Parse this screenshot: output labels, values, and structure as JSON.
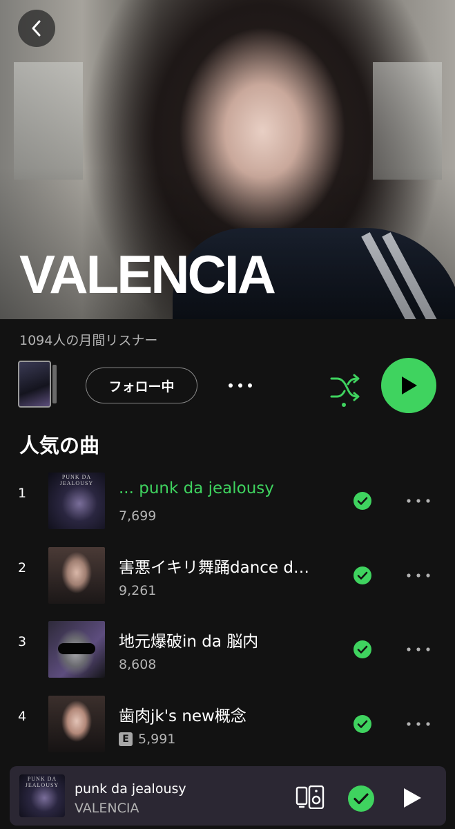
{
  "header": {
    "artist_name": "VALENCIA",
    "back_icon": "chevron-left-icon"
  },
  "stats": {
    "monthly_listeners": "1094人の月間リスナー"
  },
  "actions": {
    "follow_label": "フォロー中",
    "more_icon": "ellipsis-icon",
    "shuffle_icon": "shuffle-icon",
    "play_icon": "play-icon"
  },
  "popular": {
    "title": "人気の曲",
    "tracks": [
      {
        "number": "1",
        "title": "... punk da jealousy",
        "plays": "7,699",
        "explicit": false,
        "playing": true,
        "saved": true,
        "cover_text": "PUNK DA JEALOUSY"
      },
      {
        "number": "2",
        "title": "害悪イキリ舞踊dance d…",
        "plays": "9,261",
        "explicit": false,
        "playing": false,
        "saved": true
      },
      {
        "number": "3",
        "title": "地元爆破in da 脳内",
        "plays": "8,608",
        "explicit": false,
        "playing": false,
        "saved": true
      },
      {
        "number": "4",
        "title": "歯肉jk's new概念",
        "plays": "5,991",
        "explicit": true,
        "explicit_label": "E",
        "playing": false,
        "saved": true
      }
    ]
  },
  "now_playing": {
    "title": "punk da jealousy",
    "artist": "VALENCIA",
    "cover_text": "PUNK DA JEALOUSY",
    "device_icon": "connect-device-icon",
    "saved_icon": "check-circle-icon",
    "play_icon": "play-icon"
  },
  "colors": {
    "background": "#121212",
    "accent_green": "#3fd35f",
    "secondary_text": "#b3b3b3",
    "mini_player_bg": "#2b2733"
  }
}
